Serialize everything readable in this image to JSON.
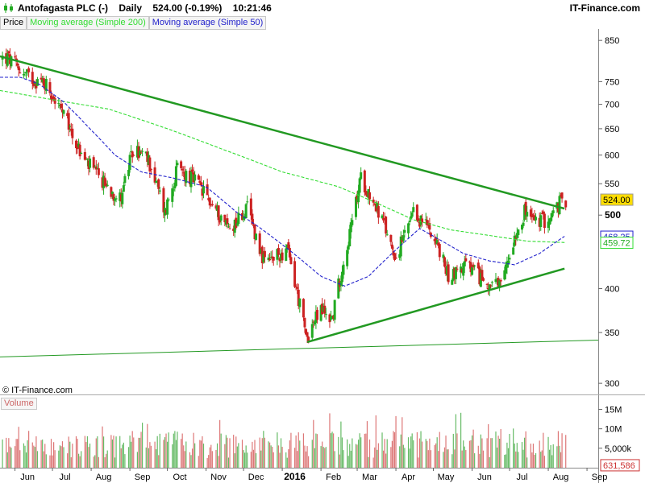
{
  "header": {
    "title": "Antofagasta PLC (-)",
    "interval": "Daily",
    "quote": "524.00 (-0.19%)",
    "time": "10:21:46",
    "site": "IT-Finance.com"
  },
  "legend": {
    "price": "Price",
    "ma200": "Moving average (Simple 200)",
    "ma50": "Moving average (Simple 50)"
  },
  "copyright": "© IT-Finance.com",
  "volume_label": "Volume",
  "colors": {
    "up": "#22aa22",
    "down": "#cc2222",
    "ma200": "#33dd33",
    "ma50": "#2222cc",
    "trendline": "#229922",
    "last_price_box": "#ffdd00",
    "ma50_box": "#2222cc",
    "ma200_box": "#33dd33",
    "volume_box": "#cc3333"
  },
  "chart_data": [
    {
      "type": "candlestick",
      "title": "Antofagasta PLC (-)",
      "scale": "log",
      "ylim": [
        290,
        880
      ],
      "y_ticks": [
        "850",
        "750",
        "700",
        "650",
        "600",
        "550",
        "500",
        "400",
        "350",
        "300"
      ],
      "y_ticks_bold": [
        "500"
      ],
      "x_ticks": [
        "Jun",
        "Jul",
        "Aug",
        "Sep",
        "Oct",
        "Nov",
        "Dec",
        "2016",
        "Feb",
        "Mar",
        "Apr",
        "May",
        "Jun",
        "Jul",
        "Aug",
        "Sep"
      ],
      "x_ticks_bold": [
        "2016"
      ],
      "x_range": [
        "2015-05-20",
        "2016-09-10"
      ],
      "grid": false,
      "legend_position": "top-left",
      "last_price": "524.00",
      "ma50_last": "468.25",
      "ma200_last": "459.72",
      "price_anchors": [
        [
          "2015-05-26",
          805
        ],
        [
          "2015-06-12",
          760
        ],
        [
          "2015-06-26",
          745
        ],
        [
          "2015-07-03",
          710
        ],
        [
          "2015-07-14",
          655
        ],
        [
          "2015-07-24",
          600
        ],
        [
          "2015-08-07",
          560
        ],
        [
          "2015-08-24",
          525
        ],
        [
          "2015-09-04",
          610
        ],
        [
          "2015-09-16",
          590
        ],
        [
          "2015-09-29",
          505
        ],
        [
          "2015-10-09",
          575
        ],
        [
          "2015-10-23",
          555
        ],
        [
          "2015-11-06",
          515
        ],
        [
          "2015-11-20",
          480
        ],
        [
          "2015-12-04",
          510
        ],
        [
          "2015-12-18",
          430
        ],
        [
          "2016-01-05",
          450
        ],
        [
          "2016-01-20",
          345
        ],
        [
          "2016-02-01",
          375
        ],
        [
          "2016-02-10",
          365
        ],
        [
          "2016-02-25",
          480
        ],
        [
          "2016-03-04",
          560
        ],
        [
          "2016-03-17",
          510
        ],
        [
          "2016-04-01",
          440
        ],
        [
          "2016-04-15",
          500
        ],
        [
          "2016-04-29",
          480
        ],
        [
          "2016-05-13",
          415
        ],
        [
          "2016-05-27",
          430
        ],
        [
          "2016-06-10",
          410
        ],
        [
          "2016-06-24",
          400
        ],
        [
          "2016-07-05",
          470
        ],
        [
          "2016-07-13",
          505
        ],
        [
          "2016-07-22",
          490
        ],
        [
          "2016-08-03",
          495
        ],
        [
          "2016-08-12",
          524
        ]
      ],
      "ma50_anchors": [
        [
          "2015-05-20",
          760
        ],
        [
          "2015-06-05",
          760
        ],
        [
          "2015-06-20",
          745
        ],
        [
          "2015-07-10",
          705
        ],
        [
          "2015-07-31",
          650
        ],
        [
          "2015-08-20",
          600
        ],
        [
          "2015-09-10",
          570
        ],
        [
          "2015-10-05",
          560
        ],
        [
          "2015-11-01",
          545
        ],
        [
          "2015-11-25",
          505
        ],
        [
          "2015-12-15",
          480
        ],
        [
          "2016-01-10",
          445
        ],
        [
          "2016-02-01",
          415
        ],
        [
          "2016-02-20",
          403
        ],
        [
          "2016-03-10",
          415
        ],
        [
          "2016-04-01",
          450
        ],
        [
          "2016-04-20",
          480
        ],
        [
          "2016-05-05",
          465
        ],
        [
          "2016-05-25",
          445
        ],
        [
          "2016-06-15",
          435
        ],
        [
          "2016-07-05",
          430
        ],
        [
          "2016-07-25",
          445
        ],
        [
          "2016-08-15",
          470
        ]
      ],
      "ma200_anchors": [
        [
          "2015-05-20",
          730
        ],
        [
          "2015-07-01",
          710
        ],
        [
          "2015-08-15",
          690
        ],
        [
          "2015-10-01",
          650
        ],
        [
          "2015-11-15",
          610
        ],
        [
          "2016-01-01",
          570
        ],
        [
          "2016-02-15",
          545
        ],
        [
          "2016-03-15",
          520
        ],
        [
          "2016-04-15",
          493
        ],
        [
          "2016-05-15",
          478
        ],
        [
          "2016-06-15",
          470
        ],
        [
          "2016-07-15",
          462
        ],
        [
          "2016-08-15",
          460
        ]
      ],
      "trendlines": [
        {
          "from": [
            "2015-05-20",
            810
          ],
          "to": [
            "2016-08-14",
            510
          ]
        },
        {
          "from": [
            "2016-01-21",
            340
          ],
          "to": [
            "2016-08-14",
            425
          ]
        },
        {
          "from": [
            "2015-05-20",
            325
          ],
          "to": [
            "2016-09-10",
            342
          ]
        }
      ]
    },
    {
      "type": "bar",
      "title": "Volume",
      "y_ticks": [
        "15M",
        "10M",
        "5,000k"
      ],
      "last_value": "631,586",
      "ylim": [
        0,
        18000000
      ]
    }
  ]
}
